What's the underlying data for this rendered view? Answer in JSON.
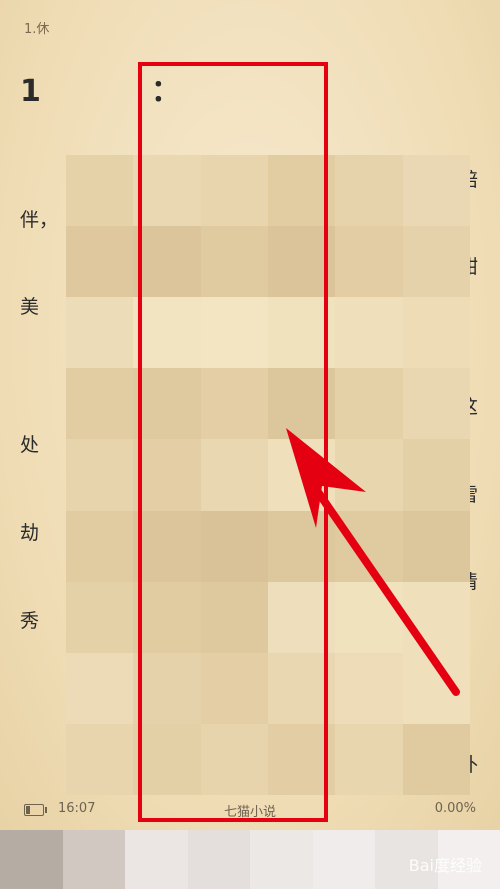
{
  "reader": {
    "chapter_small": "1.休",
    "chapter_title": "1",
    "chapter_title_end": "：",
    "left_fragments": [
      "伴，",
      "美",
      "处",
      "劫",
      "秀"
    ],
    "right_fragments": [
      "陪",
      "甜",
      "这",
      "雷",
      "清",
      "补"
    ]
  },
  "status": {
    "time": "16:07",
    "app_name": "七猫小说",
    "progress": "0.00%",
    "battery_level": 0.25
  },
  "watermark": "Bai度经验",
  "colors": {
    "highlight": "#e50011",
    "page_background": "#f2e2bf"
  }
}
